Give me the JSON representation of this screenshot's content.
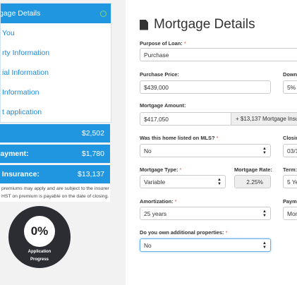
{
  "nav": {
    "items": [
      {
        "label": "gage Details",
        "active": true
      },
      {
        "label": "You"
      },
      {
        "label": "rty Information"
      },
      {
        "label": "ial Information"
      },
      {
        "label": "Information"
      },
      {
        "label": "t application"
      }
    ]
  },
  "summary": {
    "rows": [
      {
        "label": "",
        "value": "$2,502"
      },
      {
        "label": "payment:",
        "value": "$1,780"
      },
      {
        "label": "e Insurance:",
        "value": "$13,137"
      }
    ],
    "note_line1": "premiums may apply and are subject to the insurer",
    "note_line2": "HST on premium is payable on the date of closing."
  },
  "progress": {
    "percent": "0%",
    "caption_1": "Application",
    "caption_2": "Progress"
  },
  "form": {
    "title": "Mortgage Details",
    "purpose_label": "Purpose of Loan:",
    "purpose_value": "Purchase",
    "price_label": "Purchase Price:",
    "price_value": "$439,000",
    "down_label": "Down",
    "down_value": "5%",
    "amount_label": "Mortgage Amount:",
    "amount_value": "$417,050",
    "amount_addon": "+ $13,137 Mortgage Insu",
    "mls_label": "Was this home listed on MLS?",
    "mls_value": "No",
    "closing_label": "Closin",
    "closing_value": "03/1",
    "type_label": "Mortgage Type:",
    "type_value": "Variable",
    "rate_label": "Mortgage Rate:",
    "rate_value": "2.25%",
    "term_label": "Term:",
    "term_value": "5 Ye",
    "amort_label": "Amortization:",
    "amort_value": "25 years",
    "payment_label": "Payme",
    "payment_value": "Mon",
    "additional_label": "Do you own additional properties:",
    "additional_value": "No",
    "required_mark": "*"
  }
}
